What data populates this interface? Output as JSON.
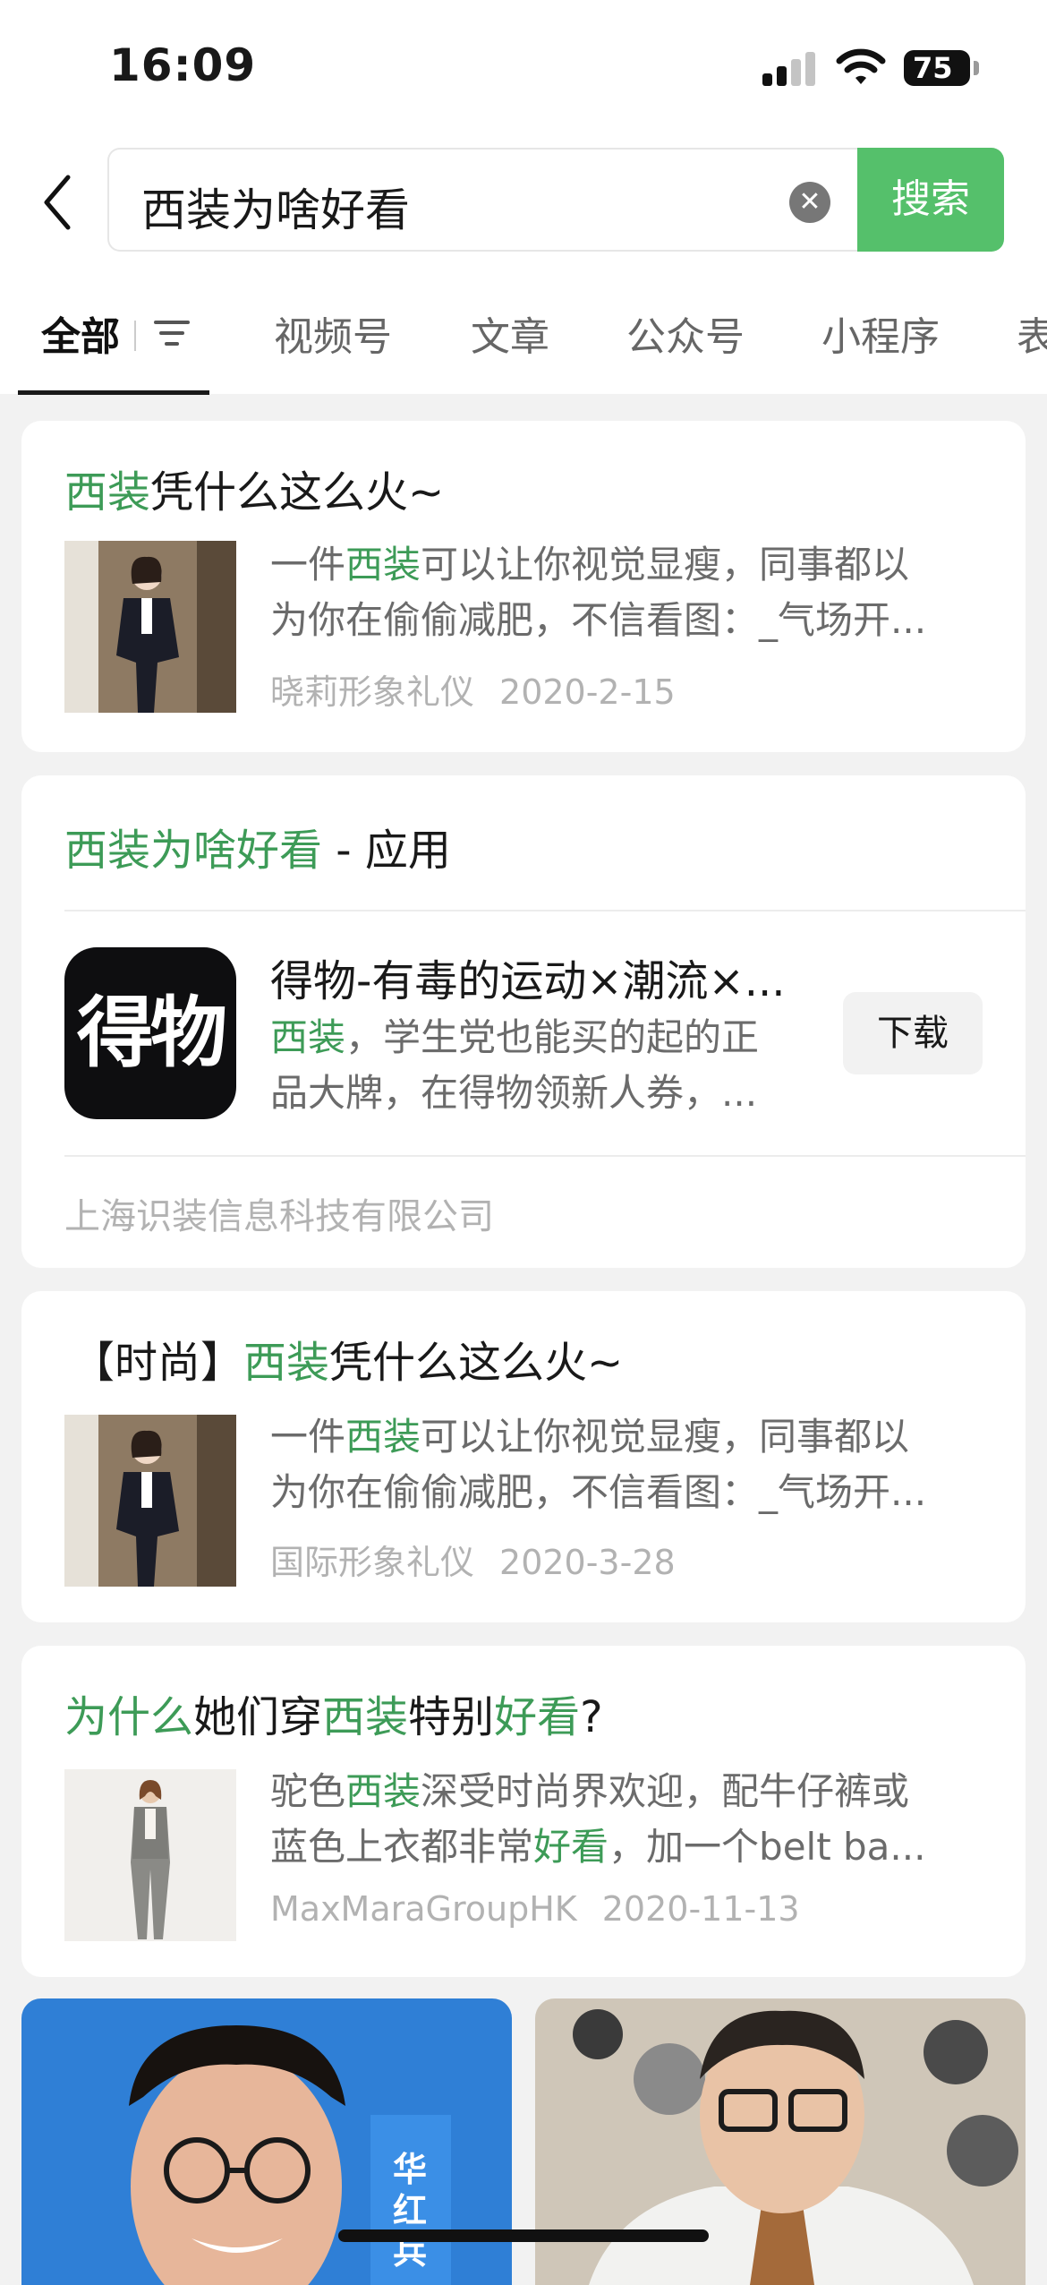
{
  "status_bar": {
    "time": "16:09",
    "battery": "75"
  },
  "search": {
    "query": "西装为啥好看",
    "button_label": "搜索"
  },
  "tabs": [
    {
      "label": "全部",
      "active": true
    },
    {
      "label": "视频号"
    },
    {
      "label": "文章"
    },
    {
      "label": "公众号"
    },
    {
      "label": "小程序"
    },
    {
      "label": "表"
    }
  ],
  "results": {
    "article1": {
      "title_hl": "西装",
      "title_rest": "凭什么这么火~",
      "snippet_l1_pre": "一件",
      "snippet_l1_hl": "西装",
      "snippet_l1_post": "可以让你视觉显瘦，同事都以",
      "snippet_l2": "为你在偷偷减肥，不信看图：_气场开...",
      "source": "晓莉形象礼仪",
      "date": "2020-2-15"
    },
    "app_section": {
      "heading_hl": "西装为啥好看",
      "heading_rest": " - 应用",
      "icon_text": "得物",
      "app_name": "得物-有毒的运动×潮流×...",
      "desc_l1_hl": "西装",
      "desc_l1_rest": "，学生党也能买的起的正",
      "desc_l2": "品大牌，在得物领新人券，...",
      "download_label": "下载",
      "company": "上海识装信息科技有限公司"
    },
    "article2": {
      "title_pre": "【时尚】",
      "title_hl": "西装",
      "title_rest": "凭什么这么火~",
      "snippet_l1_pre": "一件",
      "snippet_l1_hl": "西装",
      "snippet_l1_post": "可以让你视觉显瘦，同事都以",
      "snippet_l2": "为你在偷偷减肥，不信看图：_气场开...",
      "source": "国际形象礼仪",
      "date": "2020-3-28"
    },
    "article3": {
      "title_hl1": "为什么",
      "title_mid1": "她们穿",
      "title_hl2": "西装",
      "title_mid2": "特别",
      "title_hl3": "好看",
      "title_end": "?",
      "snippet_l1_pre": "驼色",
      "snippet_l1_hl": "西装",
      "snippet_l1_post": "深受时尚界欢迎，配牛仔裤或",
      "snippet_l2_pre": "蓝色上衣都非常",
      "snippet_l2_hl": "好看",
      "snippet_l2_post": "，加一个belt ba...",
      "source": "MaxMaraGroupHK",
      "date": "2020-11-13"
    }
  },
  "video_overlay_text": "华红兵",
  "colors": {
    "highlight": "#3d9b57",
    "search_button": "#55c06b"
  }
}
